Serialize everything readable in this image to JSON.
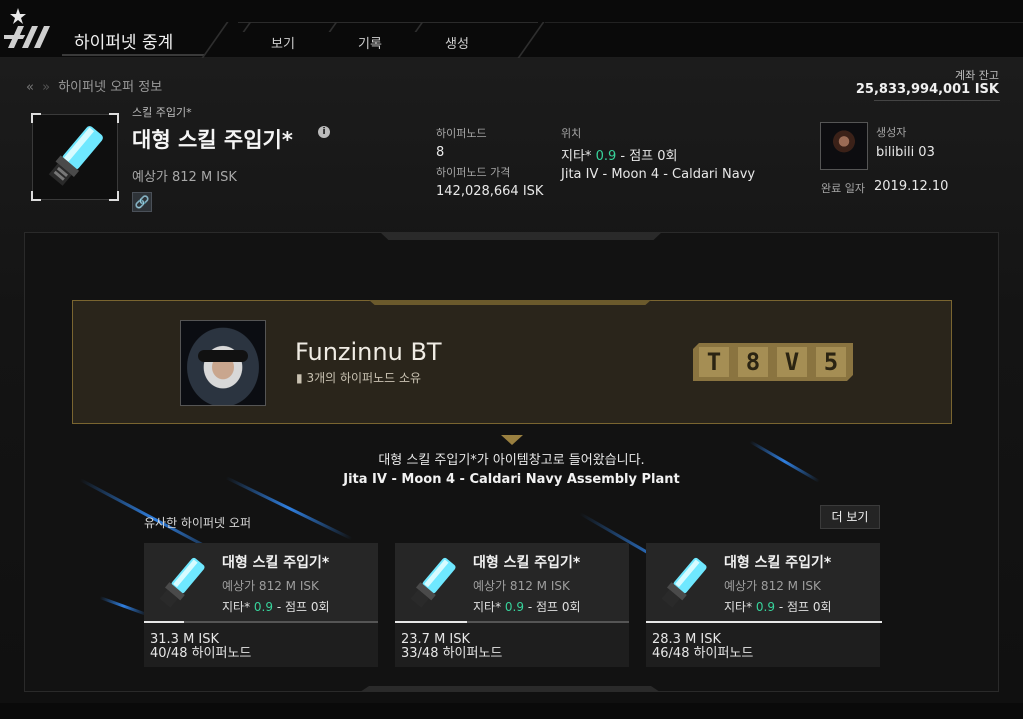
{
  "header": {
    "app_title": "하이퍼넷 중계",
    "nav": [
      "보기",
      "기록",
      "생성"
    ]
  },
  "breadcrumb": {
    "page": "하이퍼넷 오퍼 정보"
  },
  "account": {
    "balance_label": "계좌 잔고",
    "balance": "25,833,994,001 ISK"
  },
  "item": {
    "category": "스킬 주입기*",
    "name": "대형 스킬 주입기*",
    "estimate": "예상가 812 M ISK"
  },
  "offer": {
    "hypernode_label": "하이퍼노드",
    "hypernode_value": "8",
    "hypernode_price_label": "하이퍼노드 가격",
    "hypernode_price": "142,028,664 ISK",
    "location_label": "위치",
    "location_system": "지타*",
    "location_security": "0.9",
    "location_jumps": "- 점프 0회",
    "location_station": "Jita IV - Moon 4 - Caldari Navy"
  },
  "creator": {
    "label": "생성자",
    "name": "bilibili 03",
    "completed_label": "완료 일자",
    "completed_date": "2019.12.10"
  },
  "winner": {
    "name": "Funzinnu BT",
    "owned": "3개의 하이퍼노드 소유",
    "ticket": [
      "T",
      "8",
      "V",
      "5"
    ]
  },
  "result": {
    "message": "대형 스킬 주입기*가 아이템창고로 들어왔습니다.",
    "station": "Jita IV - Moon 4 - Caldari Navy Assembly Plant"
  },
  "similar": {
    "title": "유사한 하이퍼넷 오퍼",
    "more_label": "더 보기",
    "cards": [
      {
        "name": "대형 스킬 주입기*",
        "estimate": "예상가 812 M ISK",
        "system": "지타*",
        "security": "0.9",
        "jumps": "- 점프 0회",
        "price": "31.3 M ISK",
        "nodes": "40/48 하이퍼노드",
        "progress": 0.833
      },
      {
        "name": "대형 스킬 주입기*",
        "estimate": "예상가 812 M ISK",
        "system": "지타*",
        "security": "0.9",
        "jumps": "- 점프 0회",
        "price": "23.7 M ISK",
        "nodes": "33/48 하이퍼노드",
        "progress": 0.6875
      },
      {
        "name": "대형 스킬 주입기*",
        "estimate": "예상가 812 M ISK",
        "system": "지타*",
        "security": "0.9",
        "jumps": "- 점프 0회",
        "price": "28.3 M ISK",
        "nodes": "46/48 하이퍼노드",
        "progress": 0.958
      }
    ]
  },
  "colors": {
    "accent_gold": "#8a7440",
    "security_green": "#37d39b",
    "streak_blue": "#2f7fe0"
  }
}
